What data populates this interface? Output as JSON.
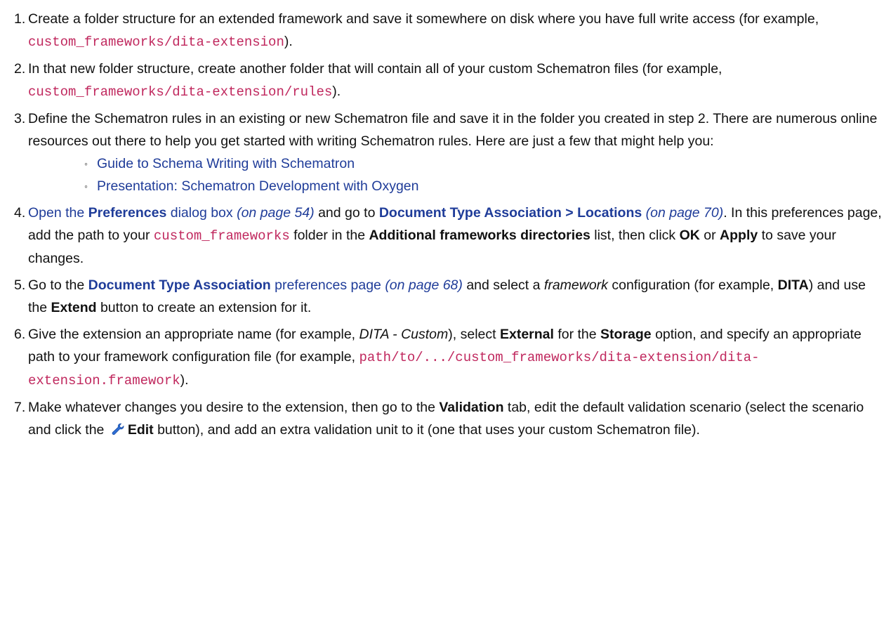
{
  "steps": [
    {
      "num": "1.",
      "t1": "Create a folder structure for an extended framework and save it somewhere on disk where you have full write access (for example, ",
      "code1": "custom_frameworks/dita-extension",
      "t2": ")."
    },
    {
      "num": "2.",
      "t1": "In that new folder structure, create another folder that will contain all of your custom Schematron files (for example, ",
      "code1": "custom_frameworks/dita-extension/rules",
      "t2": ")."
    },
    {
      "num": "3.",
      "t1": "Define the Schematron rules in an existing or new Schematron file and save it in the folder you created in step 2. There are numerous online resources out there to help you get started with writing Schematron rules. Here are just a few that might help you:",
      "links": [
        "Guide to Schema Writing with Schematron",
        "Presentation: Schematron Development with Oxygen"
      ]
    },
    {
      "num": "4.",
      "open": "Open the ",
      "preferences": "Preferences",
      "dialog": " dialog box",
      "ref1": "(on page 54)",
      "t_go": " and go to ",
      "dta_loc": "Document Type Association > Locations",
      "ref2": "(on page 70)",
      "t3": ". In this preferences page, add the path to your ",
      "code1": "custom_frameworks",
      "t4": " folder in the ",
      "additional": "Additional frameworks directories",
      "t5": " list, then click ",
      "ok": "OK",
      "or": " or ",
      "apply": "Apply",
      "t6": " to save your changes."
    },
    {
      "num": "5.",
      "go": "Go to the ",
      "dta": "Document Type Association",
      "prefpage": " preferences page",
      "ref1": "(on page 68)",
      "t1": " and select a ",
      "framework": "framework",
      "t2": " configuration (for example, ",
      "dita": "DITA",
      "t3": ") and use the ",
      "extend": "Extend",
      "t4": " button to create an extension for it."
    },
    {
      "num": "6.",
      "t1": "Give the extension an appropriate name (for example, ",
      "custom": "DITA - Custom",
      "t2": "), select ",
      "external": "External",
      "t3": " for the ",
      "storage": "Storage",
      "t4": " option, and specify an appropriate path to your framework configuration file (for example, ",
      "code1": "path/to/.../custom_frameworks/dita-extension/dita-extension.framework",
      "t5": ")."
    },
    {
      "num": "7.",
      "t1": "Make whatever changes you desire to the extension, then go to the ",
      "validation": "Validation",
      "t2": " tab, edit the default validation scenario (select the scenario and click the ",
      "edit": "Edit",
      "t3": " button), and add an extra validation unit to it (one that uses your custom Schematron file)."
    }
  ]
}
